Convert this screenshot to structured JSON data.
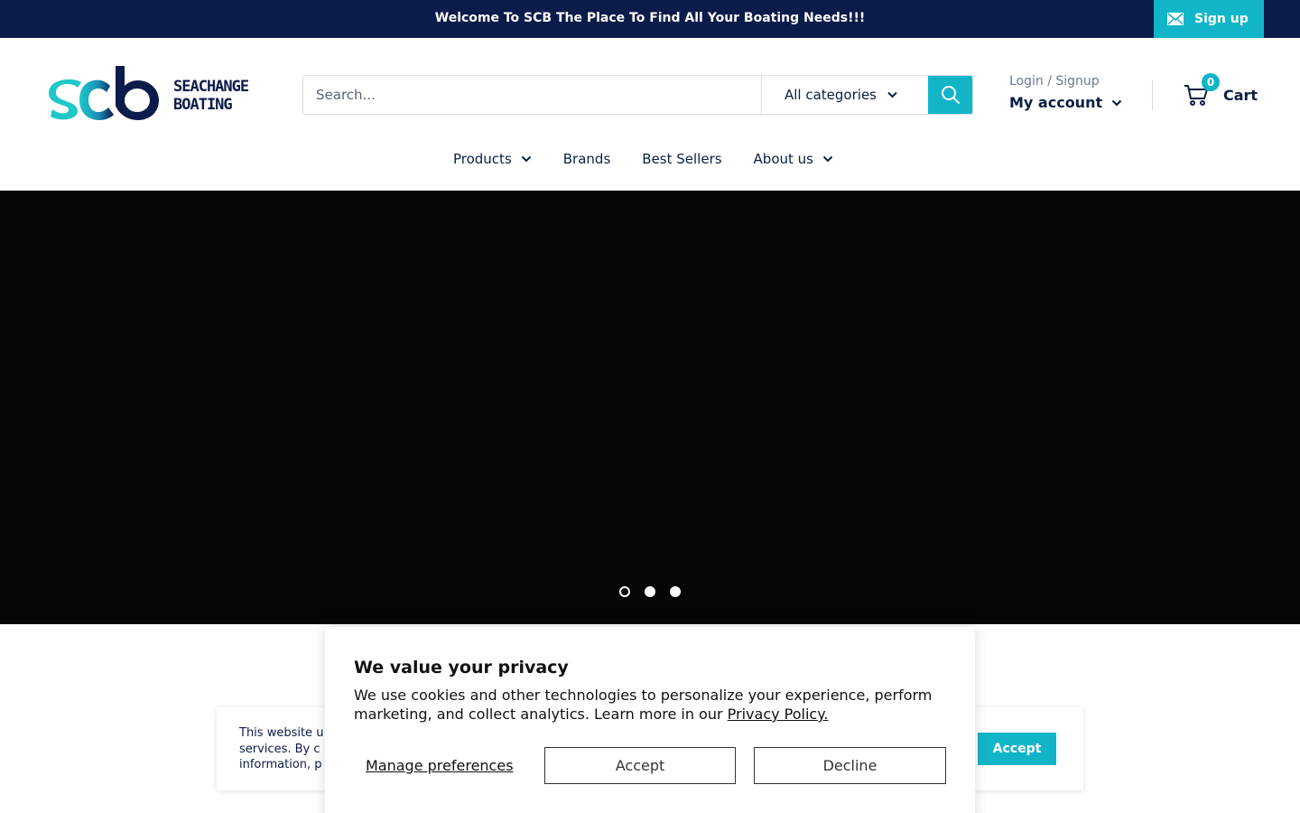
{
  "announcement": {
    "text": "Welcome To SCB The Place To Find All Your Boating Needs!!!",
    "signup_label": "Sign up"
  },
  "header": {
    "logo_words_line1": "SEACHANGE",
    "logo_words_line2": "BOATING",
    "search_placeholder": "Search...",
    "category_label": "All categories",
    "account_small": "Login / Signup",
    "account_main": "My account",
    "cart_count": "0",
    "cart_label": "Cart"
  },
  "nav": {
    "items": [
      {
        "label": "Products",
        "dropdown": true
      },
      {
        "label": "Brands",
        "dropdown": false
      },
      {
        "label": "Best Sellers",
        "dropdown": false
      },
      {
        "label": "About us",
        "dropdown": true
      }
    ]
  },
  "hero": {
    "slide_count": 3,
    "active_slide": 1
  },
  "cookie_bar": {
    "text_line1": "This website u",
    "text_line2": "services. By c",
    "text_line3": "information, p",
    "accept_label": "Accept"
  },
  "privacy": {
    "title": "We value your privacy",
    "body": "We use cookies and other technologies to personalize your experience, perform marketing, and collect analytics. Learn more in our ",
    "link_label": "Privacy Policy.",
    "manage_label": "Manage preferences",
    "accept_label": "Accept",
    "decline_label": "Decline"
  },
  "colors": {
    "navy": "#0b1b4a",
    "teal": "#12b5c8",
    "hero_bg": "#050505"
  }
}
